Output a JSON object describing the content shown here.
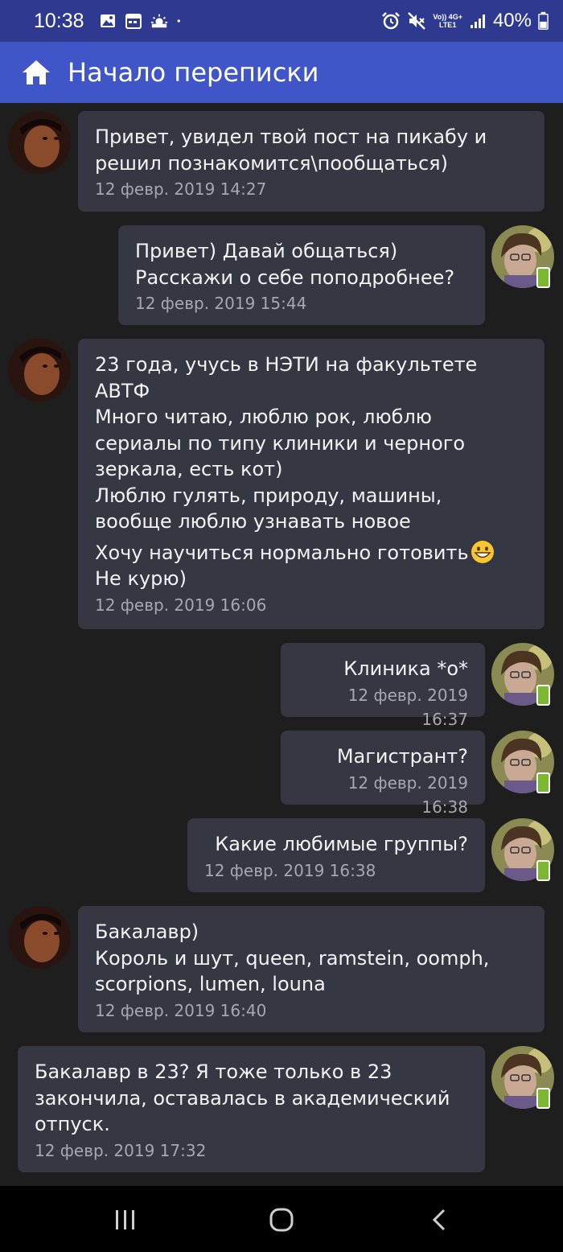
{
  "status_bar": {
    "time": "10:38",
    "battery": "40%",
    "network_top": "Vo)) 4G+",
    "network_bottom": "LTE1"
  },
  "app_bar": {
    "title": "Начало переписки",
    "icon": "home-icon"
  },
  "messages": [
    {
      "side": "left",
      "text": "Привет, увидел твой пост на пикабу и\nрешил познакомится\\пообщаться)",
      "time": "12 февр. 2019 14:27"
    },
    {
      "side": "right",
      "text": "Привет) Давай общаться)\nРасскажи о себе поподробнее?",
      "time": "12 февр. 2019 15:44"
    },
    {
      "side": "left",
      "text": "23 года, учусь в НЭТИ на факультете\nАВТФ\nМного читаю, люблю рок, люблю\nсериалы по типу клиники и черного\nзеркала, есть кот)\nЛюблю гулять, природу, машины,\nвообще люблю узнавать новое",
      "text_2": "Хочу научиться нормально готовить",
      "text_3": "Не курю)",
      "emoji": "grinning-face-emoji",
      "time": "12 февр. 2019 16:06"
    },
    {
      "side": "right",
      "text": "Клиника *о*",
      "time": "12 февр. 2019 16:37"
    },
    {
      "side": "right",
      "text": "Магистрант?",
      "time": "12 февр. 2019 16:38"
    },
    {
      "side": "right",
      "text": "Какие любимые группы?",
      "time": "12 февр. 2019 16:38"
    },
    {
      "side": "left",
      "text": "Бакалавр)\nКороль и шут, queen, ramstein, oomph,\nscorpions, lumen, louna",
      "time": "12 февр. 2019 16:40"
    },
    {
      "side": "right",
      "text": "Бакалавр в 23? Я тоже только в 23\nзакончила, оставалась в академический\nотпуск.",
      "time": "12 февр. 2019 17:32"
    }
  ],
  "colors": {
    "status_bar": "#2e3a8f",
    "app_bar": "#3f55c8",
    "background": "#1e1e1e",
    "bubble": "#353743",
    "timestamp": "#a6a8b1",
    "online_badge": "#7cb82f"
  },
  "nav_bar": {
    "icons": [
      "recent-apps-icon",
      "home-circle-icon",
      "back-icon"
    ]
  }
}
